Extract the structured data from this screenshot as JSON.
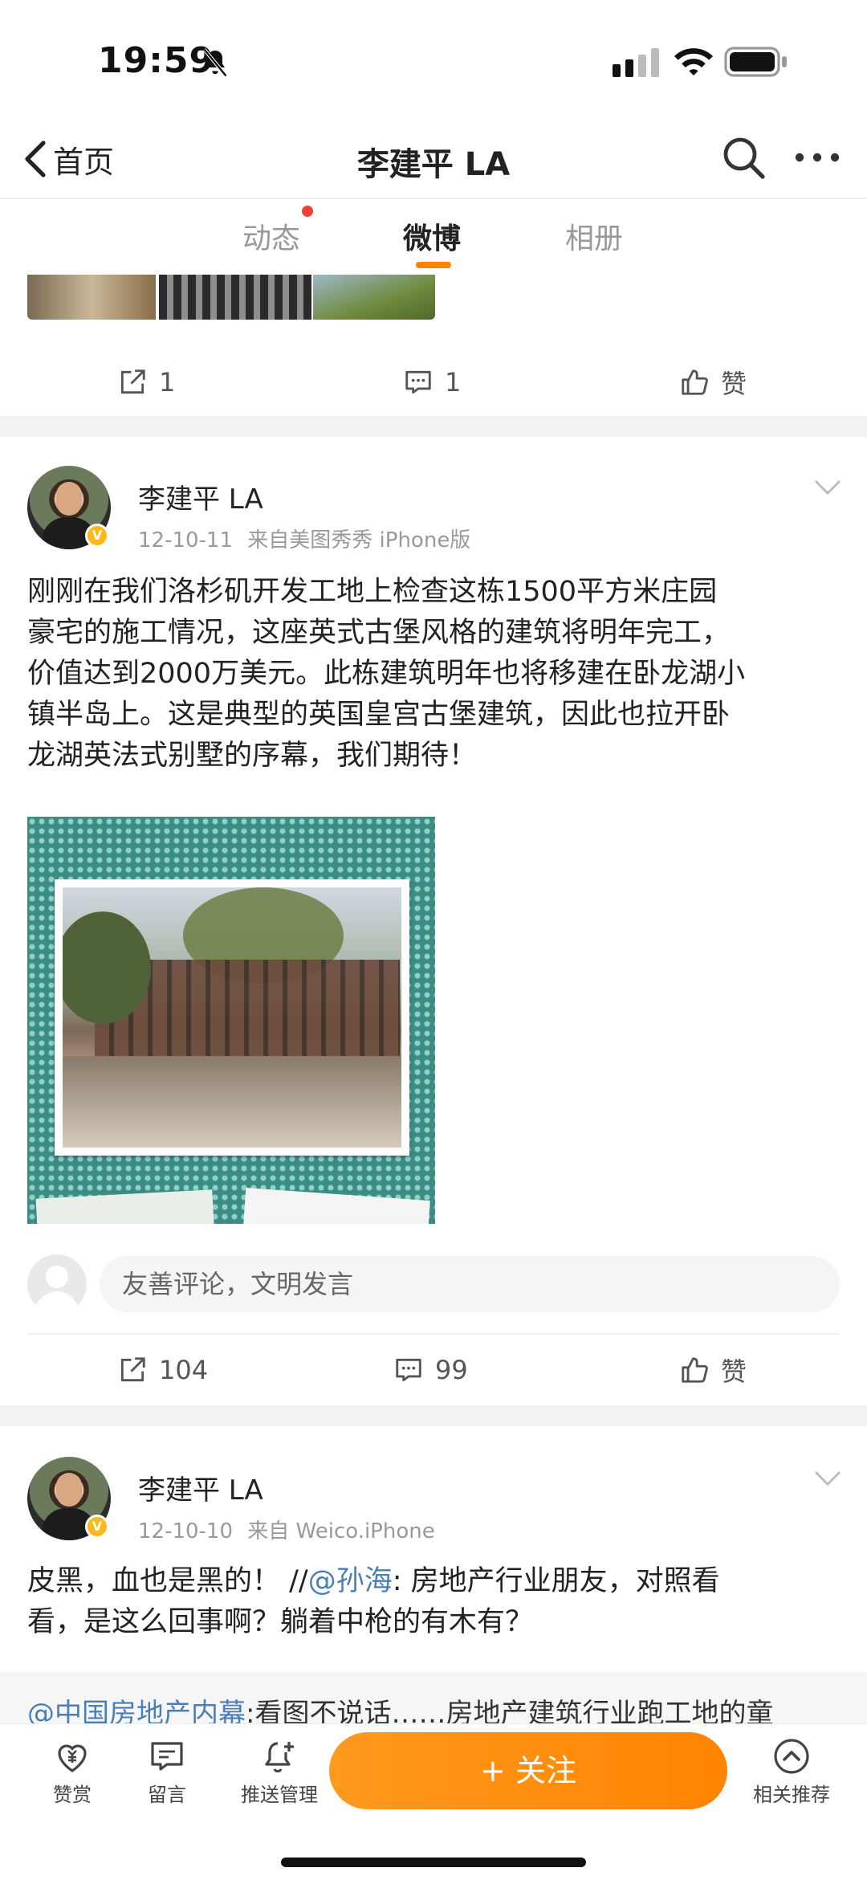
{
  "status_bar": {
    "time": "19:59"
  },
  "nav": {
    "back_label": "首页",
    "title": "李建平 LA"
  },
  "tabs": [
    {
      "label": "动态"
    },
    {
      "label": "微博"
    },
    {
      "label": "相册"
    }
  ],
  "prev_post": {
    "reposts": "1",
    "comments": "1",
    "like_label": "赞"
  },
  "post1": {
    "author": "李建平 LA",
    "date": "12-10-11",
    "source": "来自美图秀秀 iPhone版",
    "text_lines": [
      " 刚刚在我们洛杉矶开发工地上检查这栋1500平方米庄园",
      "豪宅的施工情况，这座英式古堡风格的建筑将明年完工，",
      "价值达到2000万美元。此栋建筑明年也将移建在卧龙湖小",
      "镇半岛上。这是典型的英国皇宫古堡建筑，因此也拉开卧",
      "龙湖英法式别墅的序幕，我们期待！"
    ],
    "comment_placeholder": "友善评论，文明发言",
    "reposts": "104",
    "comments": "99",
    "like_label": "赞"
  },
  "post2": {
    "author": "李建平 LA",
    "date": "12-10-10",
    "source": "来自 Weico.iPhone",
    "line1_a": "皮黑，血也是黑的！ //",
    "line1_mention": "@孙海",
    "line1_b": ": 房地产行业朋友，对照看",
    "line2": "看，是这么回事啊？躺着中枪的有木有？",
    "quote_mention": "@中国房地产内幕",
    "quote_text": ":看图不说话……房地产建筑行业跑工地的童"
  },
  "bottom_bar": {
    "reward": "赞赏",
    "message": "留言",
    "push": "推送管理",
    "follow": "+ 关注",
    "related": "相关推荐"
  },
  "colors": {
    "accent": "#ff8200",
    "mention": "#4a7fb5",
    "badge": "#ffb81c"
  }
}
